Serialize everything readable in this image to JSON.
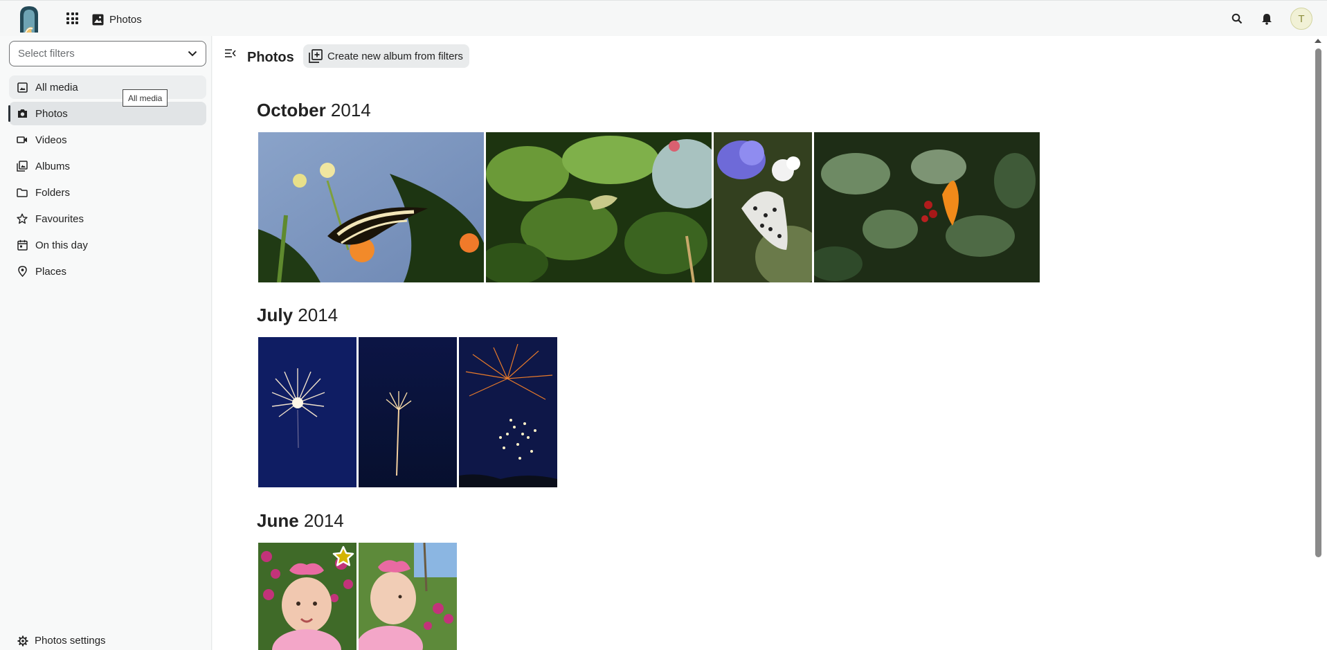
{
  "header": {
    "app_name": "Photos",
    "avatar_initial": "T"
  },
  "sidebar": {
    "filter_placeholder": "Select filters",
    "items": [
      {
        "label": "All media",
        "icon": "image-icon"
      },
      {
        "label": "Photos",
        "icon": "camera-icon"
      },
      {
        "label": "Videos",
        "icon": "video-icon"
      },
      {
        "label": "Albums",
        "icon": "albums-icon"
      },
      {
        "label": "Folders",
        "icon": "folder-icon"
      },
      {
        "label": "Favourites",
        "icon": "star-icon"
      },
      {
        "label": "On this day",
        "icon": "calendar-icon"
      },
      {
        "label": "Places",
        "icon": "map-pin-icon"
      }
    ],
    "active_item": "Photos",
    "tooltip": "All media",
    "settings_label": "Photos settings"
  },
  "main": {
    "title": "Photos",
    "create_album_label": "Create new album from filters",
    "sections": [
      {
        "month": "October",
        "year": "2014",
        "count": 4
      },
      {
        "month": "July",
        "year": "2014",
        "count": 3
      },
      {
        "month": "June",
        "year": "2014",
        "count": 2
      }
    ]
  },
  "colors": {
    "accent": "#2d3339",
    "active_bg": "#e1e4e6",
    "avatar_bg": "#f1f1d6",
    "favourite_star": "#d4b400"
  }
}
